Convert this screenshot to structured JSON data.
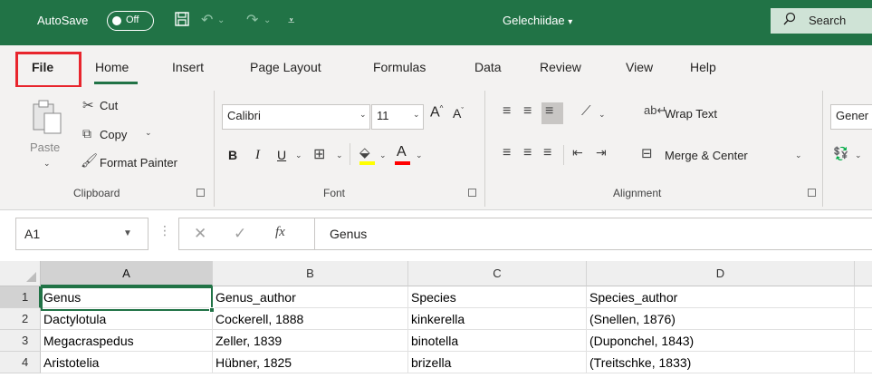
{
  "titlebar": {
    "autosave_label": "AutoSave",
    "autosave_state": "Off",
    "document_title": "Gelechiidae",
    "search_label": "Search",
    "icons": [
      "save-icon",
      "undo-icon",
      "redo-icon",
      "customize-quick-access-icon",
      "chevron-down-icon",
      "search-icon"
    ],
    "accent_color": "#217346"
  },
  "tabs": [
    "File",
    "Home",
    "Insert",
    "Page Layout",
    "Formulas",
    "Data",
    "Review",
    "View",
    "Help"
  ],
  "active_tab": "Home",
  "highlighted_tab": "File",
  "ribbon": {
    "clipboard": {
      "paste": "Paste",
      "cut": "Cut",
      "copy": "Copy",
      "format_painter": "Format Painter",
      "group_label": "Clipboard"
    },
    "font": {
      "font_name": "Calibri",
      "font_size": "11",
      "bold": "B",
      "italic": "I",
      "underline": "U",
      "increase": "A",
      "decrease": "A",
      "font_color_letter": "A",
      "group_label": "Font"
    },
    "alignment": {
      "wrap_text": "Wrap Text",
      "merge_center": "Merge & Center",
      "group_label": "Alignment"
    },
    "number": {
      "format": "Gener"
    }
  },
  "formula_bar": {
    "name_box": "A1",
    "fx": "fx",
    "formula": "Genus"
  },
  "sheet": {
    "columns": [
      "A",
      "B",
      "C",
      "D"
    ],
    "row_numbers": [
      "1",
      "2",
      "3",
      "4"
    ],
    "rows": [
      [
        "Genus",
        "Genus_author",
        "Species",
        "Species_author"
      ],
      [
        "Dactylotula",
        "Cockerell, 1888",
        "kinkerella",
        "(Snellen, 1876)"
      ],
      [
        "Megacraspedus",
        "Zeller, 1839",
        "binotella",
        "(Duponchel, 1843)"
      ],
      [
        "Aristotelia",
        "Hübner, 1825",
        "brizella",
        "(Treitschke, 1833)"
      ]
    ],
    "active_cell": "A1"
  }
}
